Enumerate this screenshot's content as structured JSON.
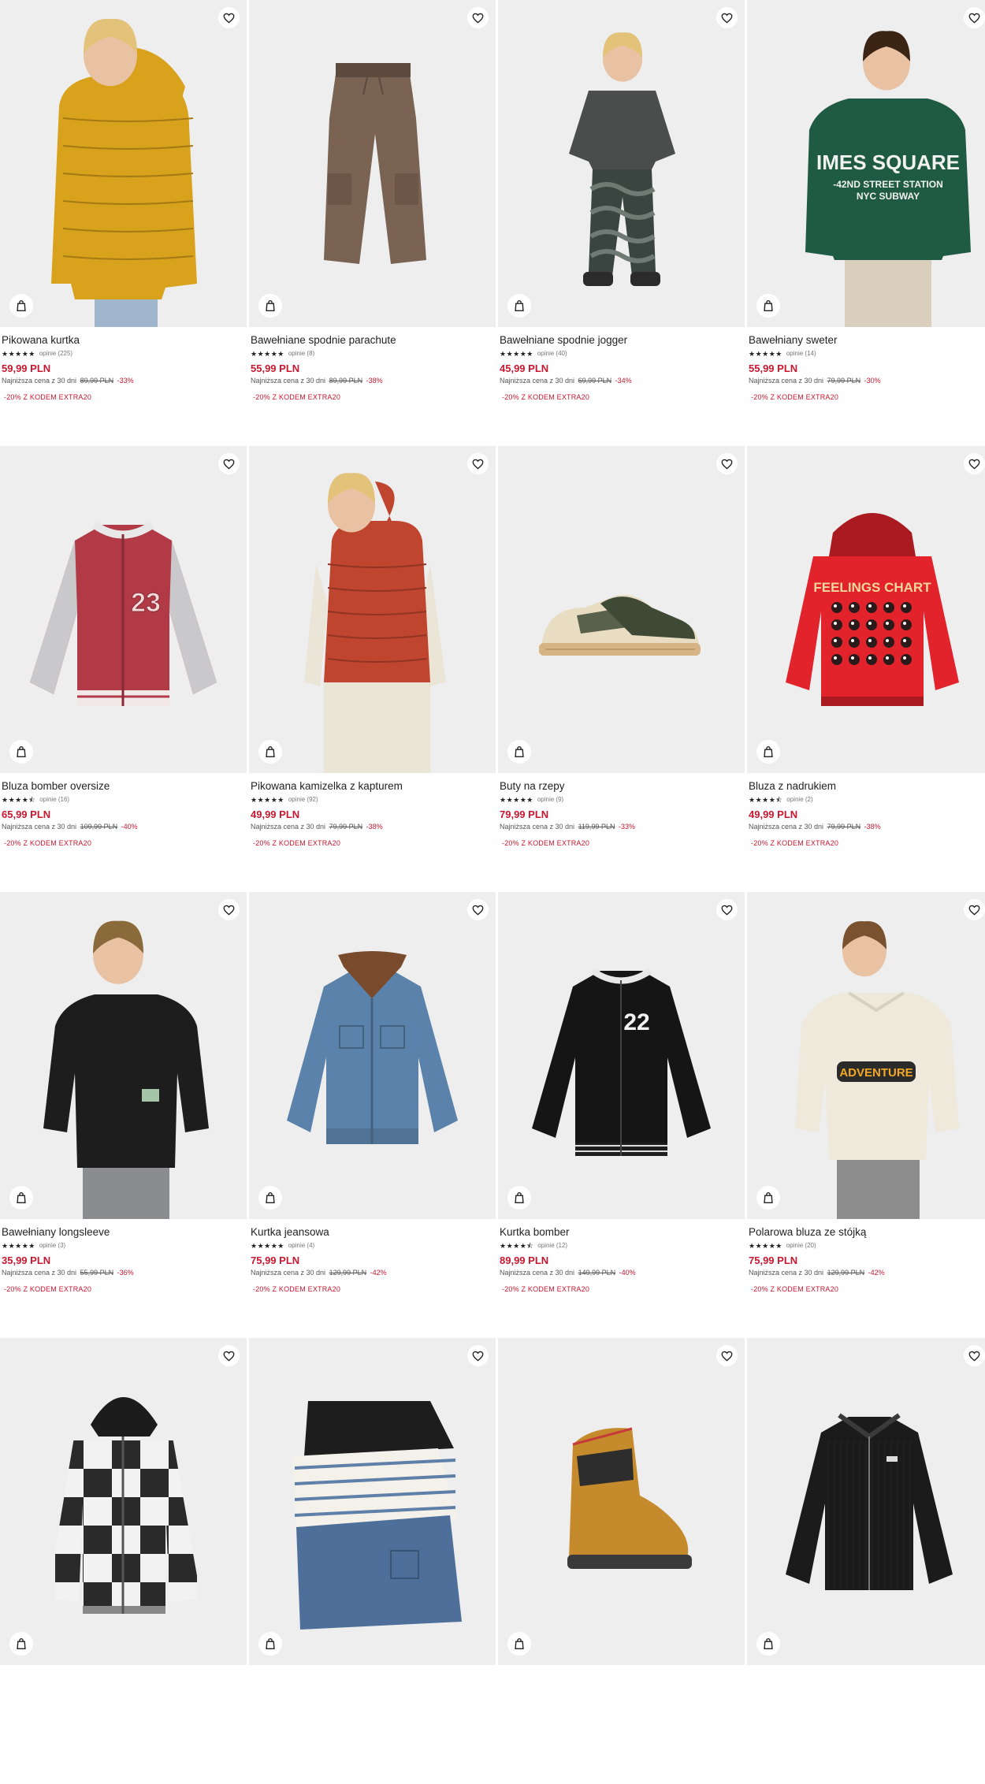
{
  "labels": {
    "reviews_prefix": "opinie",
    "lowest_price_prefix": "Najniższa cena z 30 dni",
    "currency": "PLN"
  },
  "colors": {
    "price": "#c8172f",
    "tile_background": "#eeeeef",
    "icon_button": "#ffffff"
  },
  "products": [
    {
      "name": "Pikowana kurtka",
      "rating": 5,
      "reviews": "opinie (225)",
      "price": "59,99 PLN",
      "lowest_label": "Najniższa cena z 30 dni",
      "old_price": "89,99 PLN",
      "discount": "-33%",
      "promo": "-20% Z KODEM EXTRA20",
      "illustration": "puffer-jacket-yellow",
      "color": "#d9a21c"
    },
    {
      "name": "Bawełniane spodnie parachute",
      "rating": 5,
      "reviews": "opinie (8)",
      "price": "55,99 PLN",
      "lowest_label": "Najniższa cena z 30 dni",
      "old_price": "89,99 PLN",
      "discount": "-38%",
      "promo": "-20% Z KODEM EXTRA20",
      "illustration": "trousers-brown",
      "color": "#7a6352"
    },
    {
      "name": "Bawełniane spodnie jogger",
      "rating": 5,
      "reviews": "opinie (40)",
      "price": "45,99 PLN",
      "lowest_label": "Najniższa cena z 30 dni",
      "old_price": "69,99 PLN",
      "discount": "-34%",
      "promo": "-20% Z KODEM EXTRA20",
      "illustration": "boy-camo-joggers",
      "color": "#4f5350"
    },
    {
      "name": "Bawełniany sweter",
      "rating": 5,
      "reviews": "opinie (14)",
      "price": "55,99 PLN",
      "lowest_label": "Najniższa cena z 30 dni",
      "old_price": "79,99 PLN",
      "discount": "-30%",
      "promo": "-20% Z KODEM EXTRA20",
      "illustration": "sweater-green",
      "color": "#1f5a45"
    },
    {
      "name": "Bluza bomber oversize",
      "rating": 4.5,
      "reviews": "opinie (16)",
      "price": "65,99 PLN",
      "lowest_label": "Najniższa cena z 30 dni",
      "old_price": "109,99 PLN",
      "discount": "-40%",
      "promo": "-20% Z KODEM EXTRA20",
      "illustration": "bomber-red-grey",
      "color": "#b23a47"
    },
    {
      "name": "Pikowana kamizelka z kapturem",
      "rating": 5,
      "reviews": "opinie (92)",
      "price": "49,99 PLN",
      "lowest_label": "Najniższa cena z 30 dni",
      "old_price": "79,99 PLN",
      "discount": "-38%",
      "promo": "-20% Z KODEM EXTRA20",
      "illustration": "vest-red",
      "color": "#c0452e"
    },
    {
      "name": "Buty na rzepy",
      "rating": 5,
      "reviews": "opinie (9)",
      "price": "79,99 PLN",
      "lowest_label": "Najniższa cena z 30 dni",
      "old_price": "119,99 PLN",
      "discount": "-33%",
      "promo": "-20% Z KODEM EXTRA20",
      "illustration": "sneaker-olive",
      "color": "#3f4a36"
    },
    {
      "name": "Bluza z nadrukiem",
      "rating": 4.5,
      "reviews": "opinie (2)",
      "price": "49,99 PLN",
      "lowest_label": "Najniższa cena z 30 dni",
      "old_price": "79,99 PLN",
      "discount": "-38%",
      "promo": "-20% Z KODEM EXTRA20",
      "illustration": "hoodie-red",
      "color": "#e3232c"
    },
    {
      "name": "Bawełniany longsleeve",
      "rating": 5,
      "reviews": "opinie (3)",
      "price": "35,99 PLN",
      "lowest_label": "Najniższa cena z 30 dni",
      "old_price": "55,99 PLN",
      "discount": "-36%",
      "promo": "-20% Z KODEM EXTRA20",
      "illustration": "longsleeve-black",
      "color": "#1d1d1d"
    },
    {
      "name": "Kurtka jeansowa",
      "rating": 5,
      "reviews": "opinie (4)",
      "price": "75,99 PLN",
      "lowest_label": "Najniższa cena z 30 dni",
      "old_price": "129,99 PLN",
      "discount": "-42%",
      "promo": "-20% Z KODEM EXTRA20",
      "illustration": "denim-jacket",
      "color": "#5b82aa"
    },
    {
      "name": "Kurtka bomber",
      "rating": 4.5,
      "reviews": "opinie (12)",
      "price": "89,99 PLN",
      "lowest_label": "Najniższa cena z 30 dni",
      "old_price": "149,99 PLN",
      "discount": "-40%",
      "promo": "-20% Z KODEM EXTRA20",
      "illustration": "bomber-black",
      "color": "#151515"
    },
    {
      "name": "Polarowa bluza ze stójką",
      "rating": 5,
      "reviews": "opinie (20)",
      "price": "75,99 PLN",
      "lowest_label": "Najniższa cena z 30 dni",
      "old_price": "129,99 PLN",
      "discount": "-42%",
      "promo": "-20% Z KODEM EXTRA20",
      "illustration": "fleece-cream",
      "color": "#efe9dc"
    },
    {
      "name": "",
      "rating": null,
      "reviews": "",
      "price": "",
      "lowest_label": "",
      "old_price": "",
      "discount": "",
      "promo": "",
      "illustration": "flannel-jacket-check",
      "color": "#2a2a2a"
    },
    {
      "name": "",
      "rating": null,
      "reviews": "",
      "price": "",
      "lowest_label": "",
      "old_price": "",
      "discount": "",
      "promo": "",
      "illustration": "tshirts-stack",
      "color": "#4e6f9a"
    },
    {
      "name": "",
      "rating": null,
      "reviews": "",
      "price": "",
      "lowest_label": "",
      "old_price": "",
      "discount": "",
      "promo": "",
      "illustration": "boot-tan",
      "color": "#c58a2c"
    },
    {
      "name": "",
      "rating": null,
      "reviews": "",
      "price": "",
      "lowest_label": "",
      "old_price": "",
      "discount": "",
      "promo": "",
      "illustration": "corduroy-jacket-black",
      "color": "#1b1b1b"
    }
  ],
  "icons": {
    "wishlist": "heart-outline-icon",
    "add_to_bag": "shopping-bag-icon",
    "rating_star": "star-icon"
  }
}
